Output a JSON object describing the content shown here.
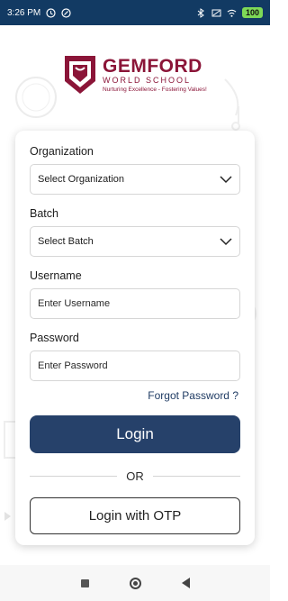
{
  "status_bar": {
    "time": "3:26 PM",
    "battery": "100"
  },
  "logo": {
    "name": "GEMFORD",
    "subtitle": "WORLD SCHOOL",
    "tagline": "Nurturing Excellence - Fostering Values!"
  },
  "form": {
    "organization": {
      "label": "Organization",
      "value": "Select Organization"
    },
    "batch": {
      "label": "Batch",
      "value": "Select Batch"
    },
    "username": {
      "label": "Username",
      "placeholder": "Enter Username"
    },
    "password": {
      "label": "Password",
      "placeholder": "Enter Password"
    },
    "forgot_password": "Forgot Password ?",
    "login_label": "Login",
    "or_label": "OR",
    "otp_label": "Login with OTP"
  },
  "colors": {
    "status_bar": "#123a63",
    "brand": "#8b1538",
    "primary_button": "#26416a",
    "link": "#1f3b63"
  },
  "icons": {
    "status": [
      "alarm-icon",
      "sync-icon",
      "bluetooth-icon",
      "sim-icon",
      "wifi-icon",
      "battery-icon"
    ],
    "nav": [
      "recents-icon",
      "home-icon",
      "back-icon"
    ]
  }
}
